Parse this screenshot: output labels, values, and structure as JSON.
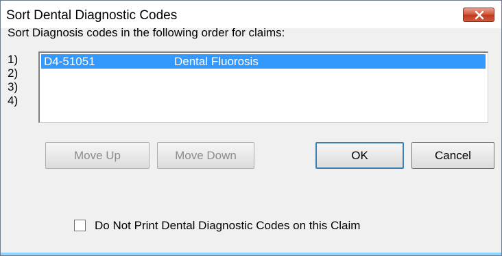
{
  "window": {
    "title": "Sort Dental Diagnostic Codes"
  },
  "dialog": {
    "instruction": "Sort Diagnosis codes in the following order for claims:",
    "row_numbers": [
      "1)",
      "2)",
      "3)",
      "4)"
    ],
    "list_items": [
      {
        "code": "D4-51051",
        "description": "Dental Fluorosis",
        "selected": true
      }
    ],
    "buttons": {
      "move_up": "Move Up",
      "move_down": "Move Down",
      "ok": "OK",
      "cancel": "Cancel"
    },
    "checkbox": {
      "label": "Do Not Print Dental Diagnostic Codes on this Claim",
      "checked": false
    }
  },
  "icons": {
    "close": "close-icon"
  },
  "colors": {
    "selection": "#3399ff",
    "close_button": "#c7432a"
  }
}
